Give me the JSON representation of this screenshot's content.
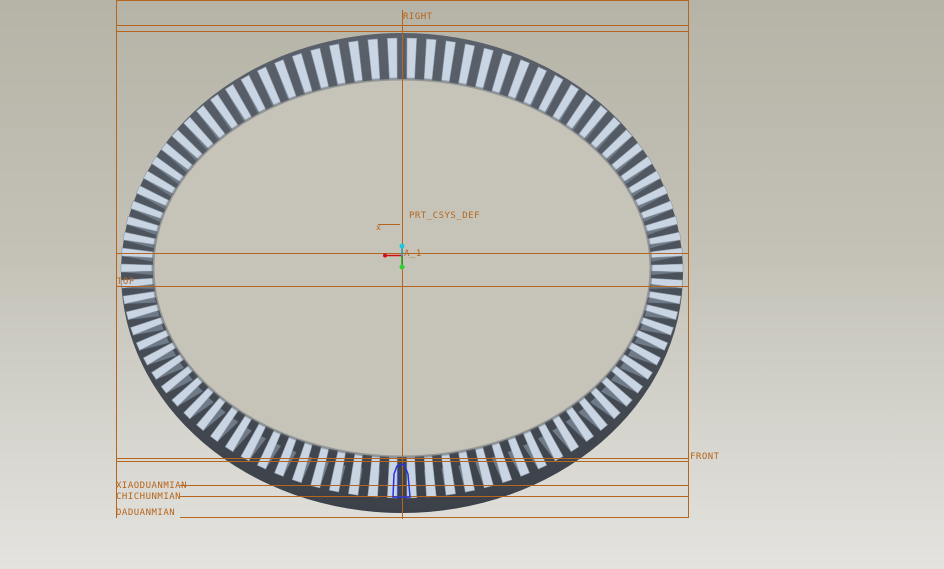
{
  "datum_planes": {
    "right": "RIGHT",
    "top": "TOP",
    "front": "FRONT",
    "xiaoduanmian": "XIAODUANMIAN",
    "chichunmian": "CHICHUNMIAN",
    "daduanmian": "DADUANMIAN"
  },
  "csys": {
    "name": "PRT_CSYS_DEF",
    "x_label": "x"
  },
  "axis": {
    "name": "A_1"
  },
  "gear": {
    "tooth_count": 90
  },
  "colors": {
    "datum": "#b5651d",
    "tooth_face": "#c9d5e3",
    "tooth_flank": "#6f7a88",
    "ring_body": "#4f5660"
  }
}
